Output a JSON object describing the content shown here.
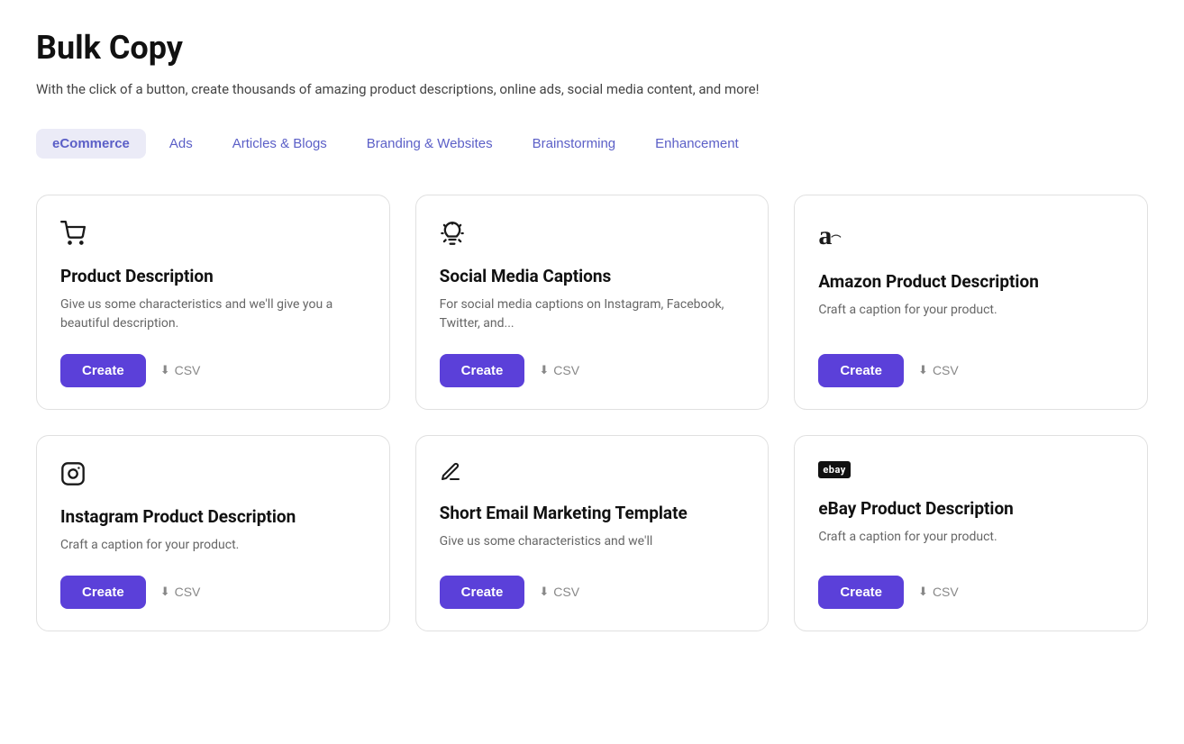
{
  "page": {
    "title": "Bulk Copy",
    "subtitle": "With the click of a button, create thousands of amazing product descriptions, online ads, social media content, and more!"
  },
  "tabs": [
    {
      "id": "ecommerce",
      "label": "eCommerce",
      "active": true
    },
    {
      "id": "ads",
      "label": "Ads",
      "active": false
    },
    {
      "id": "articles",
      "label": "Articles & Blogs",
      "active": false
    },
    {
      "id": "branding",
      "label": "Branding & Websites",
      "active": false
    },
    {
      "id": "brainstorming",
      "label": "Brainstorming",
      "active": false
    },
    {
      "id": "enhancement",
      "label": "Enhancement",
      "active": false
    }
  ],
  "cards": [
    {
      "id": "product-description",
      "icon_type": "cart",
      "title": "Product Description",
      "description": "Give us some characteristics and we'll give you a beautiful description.",
      "create_label": "Create",
      "csv_label": "CSV"
    },
    {
      "id": "social-media-captions",
      "icon_type": "lightbulb",
      "title": "Social Media Captions",
      "description": "For social media captions on Instagram, Facebook, Twitter, and...",
      "create_label": "Create",
      "csv_label": "CSV"
    },
    {
      "id": "amazon-product-description",
      "icon_type": "amazon",
      "title": "Amazon Product Description",
      "description": "Craft a caption for your product.",
      "create_label": "Create",
      "csv_label": "CSV"
    },
    {
      "id": "instagram-product-description",
      "icon_type": "instagram",
      "title": "Instagram Product Description",
      "description": "Craft a caption for your product.",
      "create_label": "Create",
      "csv_label": "CSV"
    },
    {
      "id": "short-email-marketing",
      "icon_type": "pencil",
      "title": "Short Email Marketing Template",
      "description": "Give us some characteristics and we'll",
      "create_label": "Create",
      "csv_label": "CSV"
    },
    {
      "id": "ebay-product-description",
      "icon_type": "ebay",
      "title": "eBay Product Description",
      "description": "Craft a caption for your product.",
      "create_label": "Create",
      "csv_label": "CSV"
    }
  ],
  "icons": {
    "cart": "🛒",
    "lightbulb": "💡",
    "amazon": "a",
    "instagram": "⊙",
    "pencil": "✏",
    "ebay": "ebay",
    "download": "⬇"
  }
}
